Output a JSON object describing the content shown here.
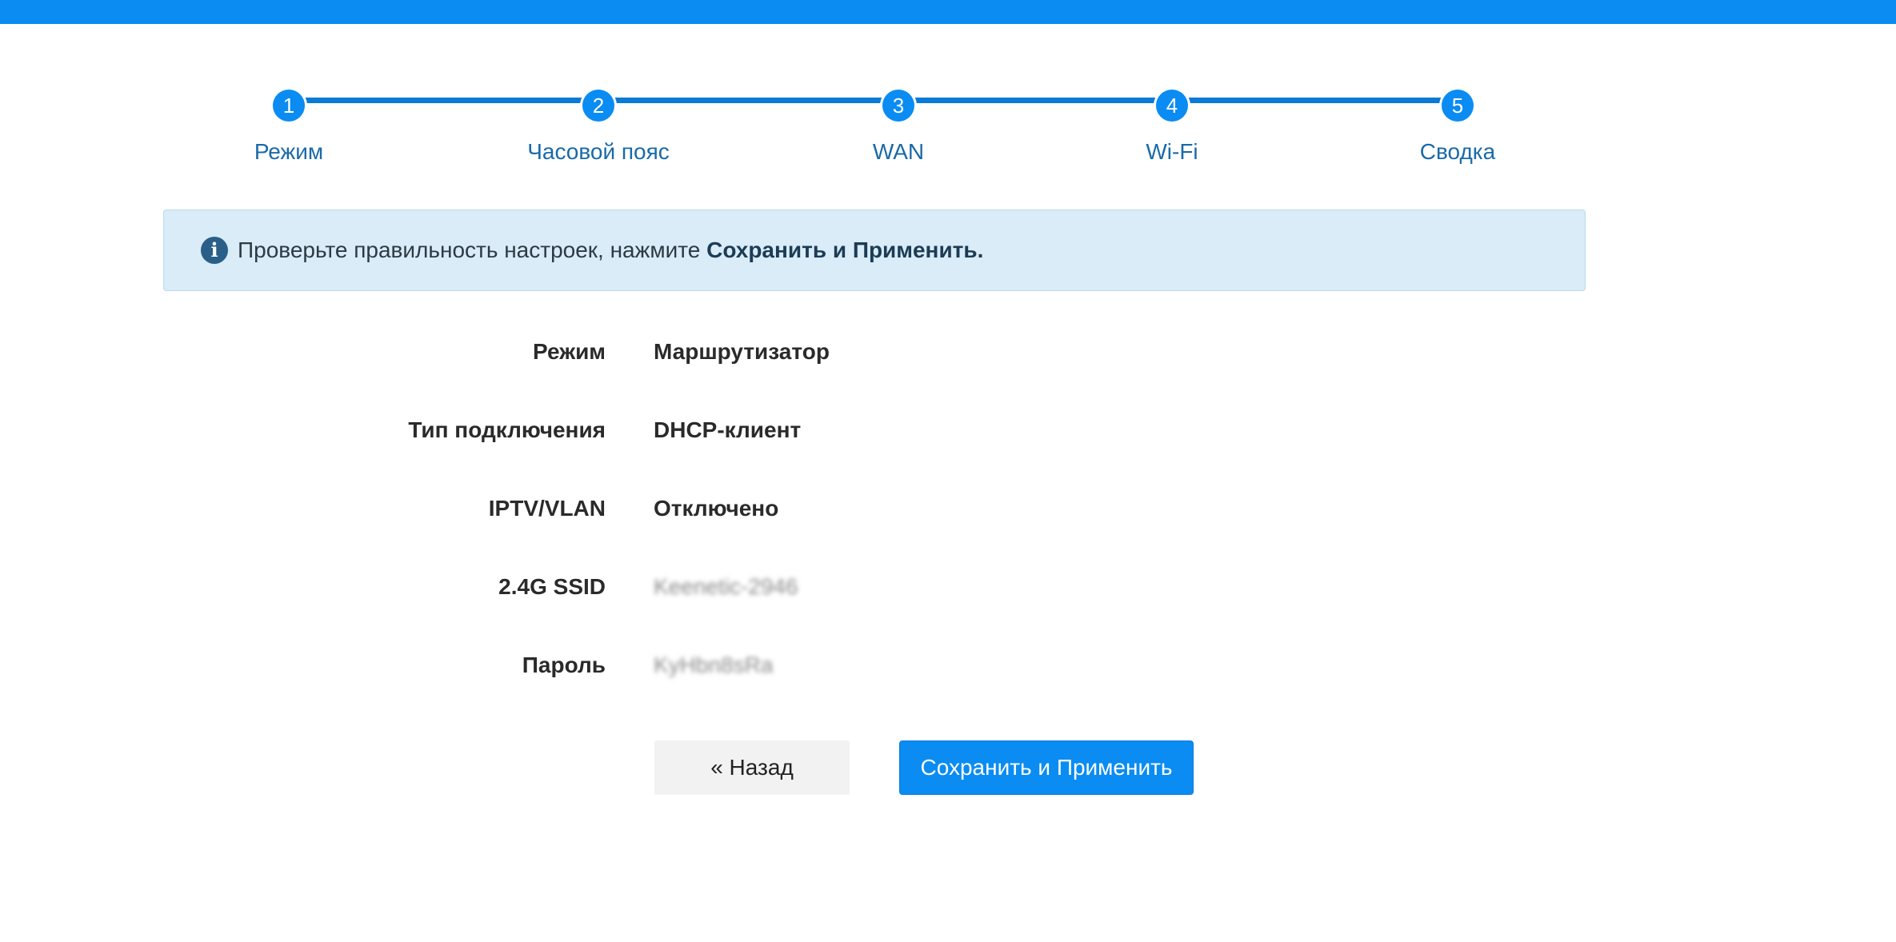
{
  "colors": {
    "accent": "#0a8cf2",
    "step_label": "#1a6aa8",
    "info_bg": "#d9ecf7",
    "info_icon": "#2a5f88"
  },
  "steps": [
    {
      "number": "1",
      "label": "Режим"
    },
    {
      "number": "2",
      "label": "Часовой пояс"
    },
    {
      "number": "3",
      "label": "WAN"
    },
    {
      "number": "4",
      "label": "Wi-Fi"
    },
    {
      "number": "5",
      "label": "Сводка"
    }
  ],
  "info": {
    "icon": "info-icon",
    "icon_glyph": "i",
    "text": "Проверьте правильность настроек, нажмите ",
    "emphasis": "Сохранить и Применить."
  },
  "summary": [
    {
      "label": "Режим",
      "value": "Маршрутизатор"
    },
    {
      "label": "Тип подключения",
      "value": "DHCP-клиент"
    },
    {
      "label": "IPTV/VLAN",
      "value": "Отключено"
    },
    {
      "label": "2.4G SSID",
      "value": "Keenetic-2946"
    },
    {
      "label": "Пароль",
      "value": "KyHbn8sRa"
    }
  ],
  "buttons": {
    "back_label": "« Назад",
    "save_label": "Сохранить и Применить"
  }
}
